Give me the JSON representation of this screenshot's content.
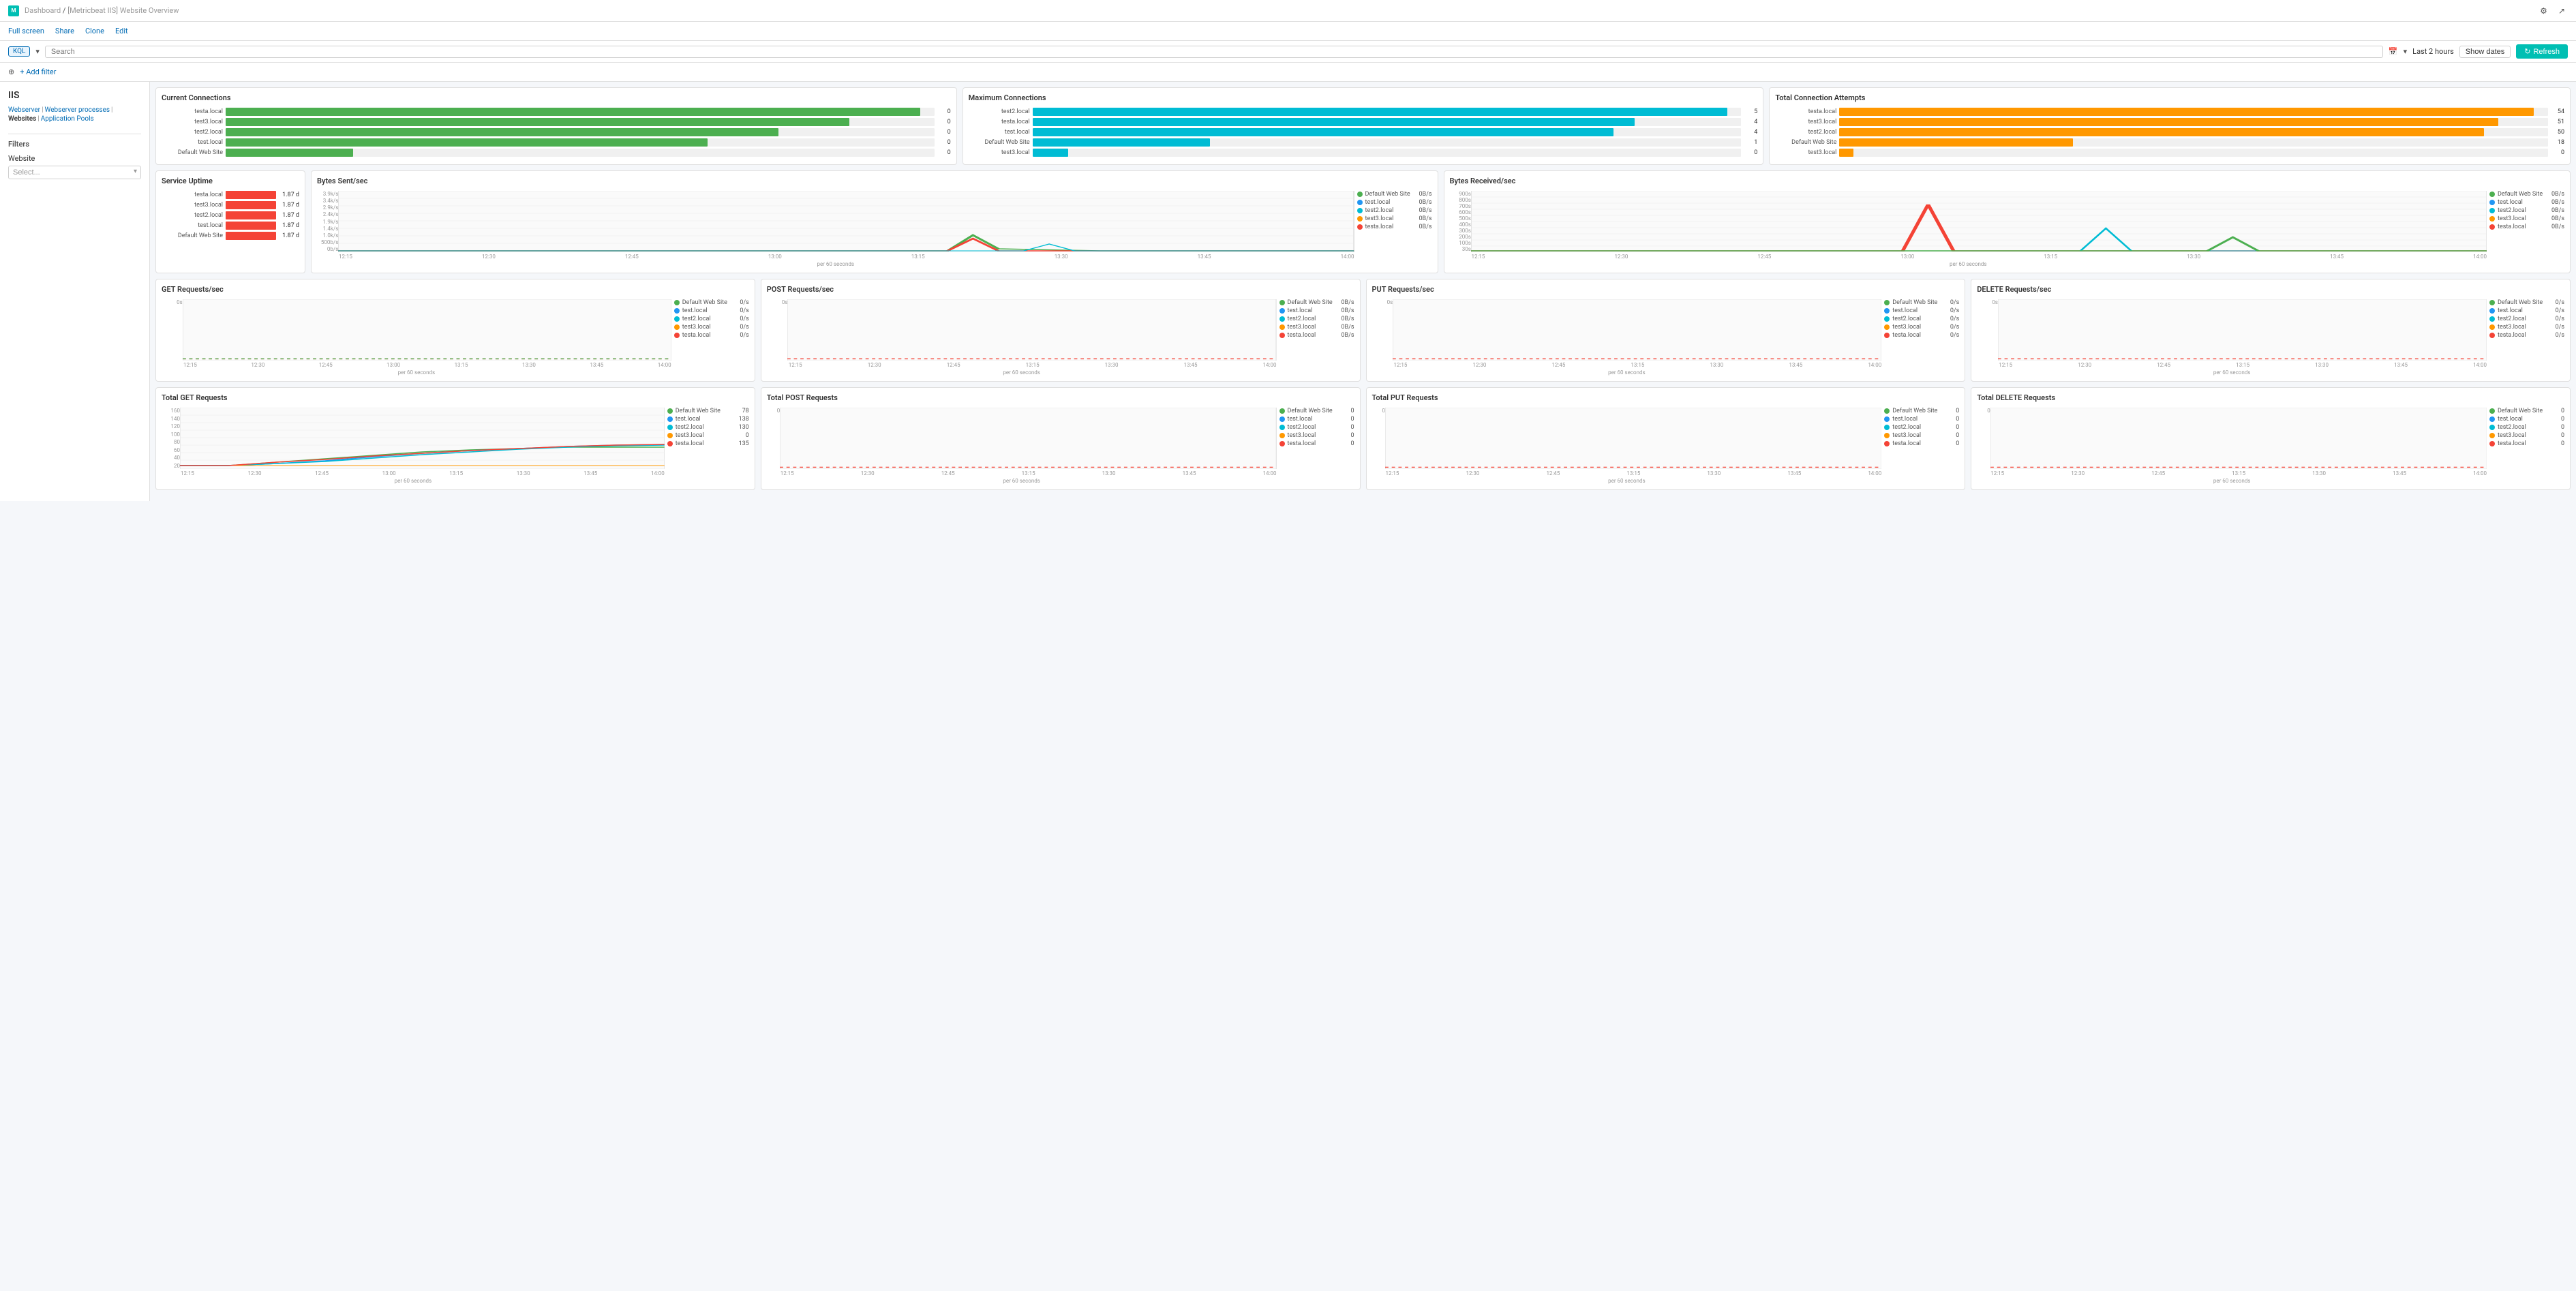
{
  "topBar": {
    "logoText": "M",
    "breadcrumb": "Dashboard",
    "title": "[Metricbeat IIS] Website Overview",
    "settingsIcon": "⚙",
    "shareIcon": "↗"
  },
  "actionBar": {
    "links": [
      "Full screen",
      "Share",
      "Clone",
      "Edit"
    ]
  },
  "searchBar": {
    "kqlLabel": "KQL",
    "placeholder": "Search",
    "calendarIcon": "📅",
    "timeRange": "Last 2 hours",
    "showDatesLabel": "Show dates",
    "refreshLabel": "Refresh"
  },
  "filterBar": {
    "addFilterLabel": "+ Add filter"
  },
  "sidebar": {
    "title": "IIS",
    "links": [
      "Webserver",
      "Webserver processes",
      "Websites",
      "Application Pools"
    ],
    "filtersTitle": "Filters",
    "websiteLabel": "Website",
    "websitePlaceholder": "Select..."
  },
  "currentConnections": {
    "title": "Current Connections",
    "items": [
      {
        "label": "testa.local",
        "value": 0,
        "pct": 98
      },
      {
        "label": "test3.local",
        "value": 0,
        "pct": 88
      },
      {
        "label": "test2.local",
        "value": 0,
        "pct": 78
      },
      {
        "label": "test.local",
        "value": 0,
        "pct": 68
      },
      {
        "label": "Default Web Site",
        "value": 0,
        "pct": 18
      }
    ]
  },
  "maximumConnections": {
    "title": "Maximum Connections",
    "items": [
      {
        "label": "test2.local",
        "value": 5,
        "pct": 98
      },
      {
        "label": "testa.local",
        "value": 4,
        "pct": 85
      },
      {
        "label": "test.local",
        "value": 4,
        "pct": 82
      },
      {
        "label": "Default Web Site",
        "value": 1,
        "pct": 25
      },
      {
        "label": "test3.local",
        "value": 0,
        "pct": 5
      }
    ]
  },
  "totalConnectionAttempts": {
    "title": "Total Connection Attempts",
    "items": [
      {
        "label": "testa.local",
        "value": 54,
        "pct": 98
      },
      {
        "label": "test3.local",
        "value": 51,
        "pct": 93
      },
      {
        "label": "test2.local",
        "value": 50,
        "pct": 91
      },
      {
        "label": "Default Web Site",
        "value": 18,
        "pct": 33
      },
      {
        "label": "test3.local",
        "value": 0,
        "pct": 2
      }
    ]
  },
  "serviceUptime": {
    "title": "Service Uptime",
    "items": [
      {
        "label": "testa.local",
        "value": "1.87 d"
      },
      {
        "label": "test3.local",
        "value": "1.87 d"
      },
      {
        "label": "test2.local",
        "value": "1.87 d"
      },
      {
        "label": "test.local",
        "value": "1.87 d"
      },
      {
        "label": "Default Web Site",
        "value": "1.87 d"
      }
    ]
  },
  "bytesSent": {
    "title": "Bytes Sent/sec",
    "yLabels": [
      "3.9k/s",
      "3.4k/s",
      "2.9k/s",
      "2.4k/s",
      "1.9k/s",
      "1.4k/s",
      "1.0k/s",
      "500b/s",
      "0b/s"
    ],
    "xLabels": [
      "12:15",
      "12:30",
      "12:45",
      "13:00",
      "13:15",
      "13:30",
      "13:45",
      "14:00"
    ],
    "subtitle": "per 60 seconds",
    "legend": [
      {
        "label": "Default Web Site",
        "color": "#4caf50",
        "value": "0B/s"
      },
      {
        "label": "test.local",
        "color": "#2196f3",
        "value": "0B/s"
      },
      {
        "label": "test2.local",
        "color": "#00bcd4",
        "value": "0B/s"
      },
      {
        "label": "test3.local",
        "color": "#ff9800",
        "value": "0B/s"
      },
      {
        "label": "testa.local",
        "color": "#f44336",
        "value": "0B/s"
      }
    ]
  },
  "bytesReceived": {
    "title": "Bytes Received/sec",
    "yLabels": [
      "900s",
      "800s",
      "700s",
      "600s",
      "500s",
      "400s",
      "300s",
      "200s",
      "100s",
      "30s"
    ],
    "xLabels": [
      "12:15",
      "12:30",
      "12:45",
      "13:00",
      "13:15",
      "13:30",
      "13:45",
      "14:00"
    ],
    "subtitle": "per 60 seconds",
    "legend": [
      {
        "label": "Default Web Site",
        "color": "#4caf50",
        "value": "0B/s"
      },
      {
        "label": "test.local",
        "color": "#2196f3",
        "value": "0B/s"
      },
      {
        "label": "test2.local",
        "color": "#00bcd4",
        "value": "0B/s"
      },
      {
        "label": "test3.local",
        "color": "#ff9800",
        "value": "0B/s"
      },
      {
        "label": "testa.local",
        "color": "#f44336",
        "value": "0B/s"
      }
    ]
  },
  "getRequests": {
    "title": "GET Requests/sec",
    "yLabels": [
      "0s"
    ],
    "xLabels": [
      "12:15",
      "12:30",
      "12:45",
      "13:00",
      "13:15",
      "13:30",
      "13:45",
      "14:00"
    ],
    "subtitle": "per 60 seconds",
    "legend": [
      {
        "label": "Default Web Site",
        "color": "#4caf50",
        "value": "0/s"
      },
      {
        "label": "test.local",
        "color": "#2196f3",
        "value": "0/s"
      },
      {
        "label": "test2.local",
        "color": "#00bcd4",
        "value": "0/s"
      },
      {
        "label": "test3.local",
        "color": "#ff9800",
        "value": "0/s"
      },
      {
        "label": "testa.local",
        "color": "#f44336",
        "value": "0/s"
      }
    ]
  },
  "postRequests": {
    "title": "POST Requests/sec",
    "yLabels": [
      "0s"
    ],
    "xLabels": [
      "12:15",
      "12:30",
      "12:45",
      "13:00",
      "13:15",
      "13:30",
      "13:45",
      "14:00"
    ],
    "subtitle": "per 60 seconds",
    "legend": [
      {
        "label": "Default Web Site",
        "color": "#4caf50",
        "value": "0B/s"
      },
      {
        "label": "test.local",
        "color": "#2196f3",
        "value": "0B/s"
      },
      {
        "label": "test2.local",
        "color": "#00bcd4",
        "value": "0B/s"
      },
      {
        "label": "test3.local",
        "color": "#ff9800",
        "value": "0B/s"
      },
      {
        "label": "testa.local",
        "color": "#f44336",
        "value": "0B/s"
      }
    ]
  },
  "putRequests": {
    "title": "PUT Requests/sec",
    "yLabels": [
      "0s"
    ],
    "xLabels": [
      "12:15",
      "12:30",
      "12:45",
      "13:00",
      "13:15",
      "13:30",
      "13:45",
      "14:00"
    ],
    "subtitle": "per 60 seconds",
    "legend": [
      {
        "label": "Default Web Site",
        "color": "#4caf50",
        "value": "0/s"
      },
      {
        "label": "test.local",
        "color": "#2196f3",
        "value": "0/s"
      },
      {
        "label": "test2.local",
        "color": "#00bcd4",
        "value": "0/s"
      },
      {
        "label": "test3.local",
        "color": "#ff9800",
        "value": "0/s"
      },
      {
        "label": "testa.local",
        "color": "#f44336",
        "value": "0/s"
      }
    ]
  },
  "deleteRequests": {
    "title": "DELETE Requests/sec",
    "yLabels": [
      "0s"
    ],
    "xLabels": [
      "12:15",
      "12:30",
      "12:45",
      "13:00",
      "13:15",
      "13:30",
      "13:45",
      "14:00"
    ],
    "subtitle": "per 60 seconds",
    "legend": [
      {
        "label": "Default Web Site",
        "color": "#4caf50",
        "value": "0/s"
      },
      {
        "label": "test.local",
        "color": "#2196f3",
        "value": "0/s"
      },
      {
        "label": "test2.local",
        "color": "#00bcd4",
        "value": "0/s"
      },
      {
        "label": "test3.local",
        "color": "#ff9800",
        "value": "0/s"
      },
      {
        "label": "testa.local",
        "color": "#f44336",
        "value": "0/s"
      }
    ]
  },
  "totalGetRequests": {
    "title": "Total GET Requests",
    "yLabels": [
      "160",
      "140",
      "120",
      "100",
      "80",
      "60",
      "40",
      "20"
    ],
    "xLabels": [
      "12:15",
      "12:30",
      "12:45",
      "13:00",
      "13:15",
      "13:30",
      "13:45",
      "14:00"
    ],
    "subtitle": "per 60 seconds",
    "legend": [
      {
        "label": "Default Web Site",
        "color": "#4caf50",
        "value": "78"
      },
      {
        "label": "test.local",
        "color": "#2196f3",
        "value": "138"
      },
      {
        "label": "test2.local",
        "color": "#00bcd4",
        "value": "130"
      },
      {
        "label": "test3.local",
        "color": "#ff9800",
        "value": "0"
      },
      {
        "label": "testa.local",
        "color": "#f44336",
        "value": "135"
      }
    ]
  },
  "totalPostRequests": {
    "title": "Total POST Requests",
    "yLabels": [
      "0"
    ],
    "xLabels": [
      "12:15",
      "12:30",
      "12:45",
      "13:00",
      "13:15",
      "13:30",
      "13:45",
      "14:00"
    ],
    "subtitle": "per 60 seconds",
    "legend": [
      {
        "label": "Default Web Site",
        "color": "#4caf50",
        "value": "0"
      },
      {
        "label": "test.local",
        "color": "#2196f3",
        "value": "0"
      },
      {
        "label": "test2.local",
        "color": "#00bcd4",
        "value": "0"
      },
      {
        "label": "test3.local",
        "color": "#ff9800",
        "value": "0"
      },
      {
        "label": "testa.local",
        "color": "#f44336",
        "value": "0"
      }
    ]
  },
  "totalPutRequests": {
    "title": "Total PUT Requests",
    "yLabels": [
      "0"
    ],
    "xLabels": [
      "12:15",
      "12:30",
      "12:45",
      "13:00",
      "13:15",
      "13:30",
      "13:45",
      "14:00"
    ],
    "subtitle": "per 60 seconds",
    "legend": [
      {
        "label": "Default Web Site",
        "color": "#4caf50",
        "value": "0"
      },
      {
        "label": "test.local",
        "color": "#2196f3",
        "value": "0"
      },
      {
        "label": "test2.local",
        "color": "#00bcd4",
        "value": "0"
      },
      {
        "label": "test3.local",
        "color": "#ff9800",
        "value": "0"
      },
      {
        "label": "testa.local",
        "color": "#f44336",
        "value": "0"
      }
    ]
  },
  "totalDeleteRequests": {
    "title": "Total DELETE Requests",
    "yLabels": [
      "0"
    ],
    "xLabels": [
      "12:15",
      "12:30",
      "12:45",
      "13:00",
      "13:15",
      "13:30",
      "13:45",
      "14:00"
    ],
    "subtitle": "per 60 seconds",
    "legend": [
      {
        "label": "Default Web Site",
        "color": "#4caf50",
        "value": "0"
      },
      {
        "label": "test.local",
        "color": "#2196f3",
        "value": "0"
      },
      {
        "label": "test2.local",
        "color": "#00bcd4",
        "value": "0"
      },
      {
        "label": "test3.local",
        "color": "#ff9800",
        "value": "0"
      },
      {
        "label": "testa.local",
        "color": "#f44336",
        "value": "0"
      }
    ]
  }
}
